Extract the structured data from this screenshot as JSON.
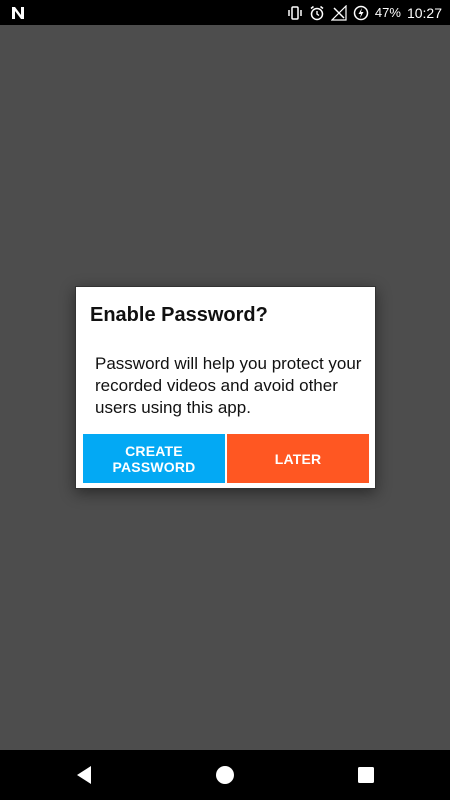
{
  "status_bar": {
    "battery_percent": "47%",
    "time": "10:27",
    "icons": [
      "n-logo-icon",
      "vibrate-icon",
      "alarm-icon",
      "no-signal-icon",
      "battery-charging-icon"
    ]
  },
  "dialog": {
    "title": "Enable Password?",
    "message": "Password will help you protect your recorded videos and avoid other users using this app.",
    "create_label": "CREATE PASSWORD",
    "later_label": "LATER"
  },
  "nav_bar": {
    "icons": [
      "back-icon",
      "home-icon",
      "recents-icon"
    ]
  },
  "colors": {
    "backdrop": "#4d4d4d",
    "create_button": "#03a9f4",
    "later_button": "#ff5722"
  }
}
